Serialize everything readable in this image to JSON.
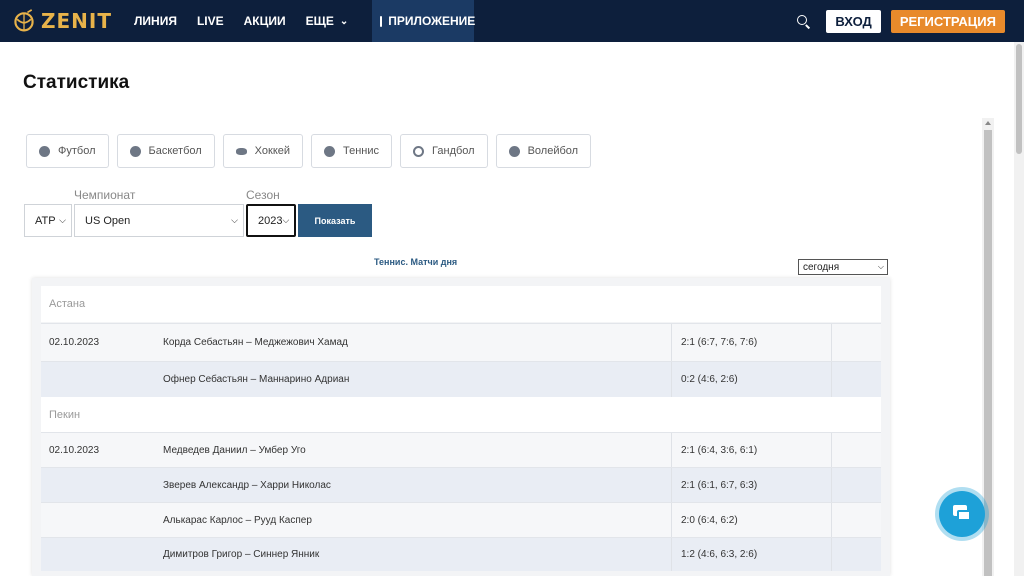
{
  "header": {
    "logo_text": "ZENIT",
    "nav": [
      "ЛИНИЯ",
      "LIVE",
      "АКЦИИ",
      "ЕЩЕ"
    ],
    "app_label": "ПРИЛОЖЕНИЕ",
    "login_label": "ВХОД",
    "register_label": "РЕГИСТРАЦИЯ"
  },
  "page_title": "Статистика",
  "sports": [
    {
      "label": "Футбол",
      "icon": "football-icon"
    },
    {
      "label": "Баскетбол",
      "icon": "basketball-icon"
    },
    {
      "label": "Хоккей",
      "icon": "hockey-icon"
    },
    {
      "label": "Теннис",
      "icon": "tennis-icon"
    },
    {
      "label": "Гандбол",
      "icon": "handball-icon"
    },
    {
      "label": "Волейбол",
      "icon": "volleyball-icon"
    }
  ],
  "filters": {
    "championship_label": "Чемпионат",
    "season_label": "Сезон",
    "tour_value": "ATP",
    "championship_value": "US Open",
    "season_value": "2023",
    "show_button": "Показать"
  },
  "matches_caption": "Теннис. Матчи дня",
  "day_select": "сегодня",
  "groups": [
    {
      "name": "Астана",
      "matches": [
        {
          "date": "02.10.2023",
          "players": "Корда Себастьян – Меджежович Хамад",
          "score": "2:1 (6:7, 7:6, 7:6)"
        },
        {
          "date": "",
          "players": "Офнер Себастьян – Маннарино Адриан",
          "score": "0:2 (4:6, 2:6)"
        }
      ]
    },
    {
      "name": "Пекин",
      "matches": [
        {
          "date": "02.10.2023",
          "players": "Медведев Даниил – Умбер Уго",
          "score": "2:1 (6:4, 3:6, 6:1)"
        },
        {
          "date": "",
          "players": "Зверев Александр – Харри Николас",
          "score": "2:1 (6:1, 6:7, 6:3)"
        },
        {
          "date": "",
          "players": "Алькарас Карлос – Рууд Каспер",
          "score": "2:0 (6:4, 6:2)"
        },
        {
          "date": "",
          "players": "Димитров Григор – Синнер Янник",
          "score": "1:2 (4:6, 6:3, 2:6)"
        }
      ]
    }
  ],
  "colors": {
    "header_bg": "#0d1f3c",
    "accent_orange": "#e88a2b",
    "button_blue": "#2b5a82",
    "chat_blue": "#1ea1d8"
  }
}
